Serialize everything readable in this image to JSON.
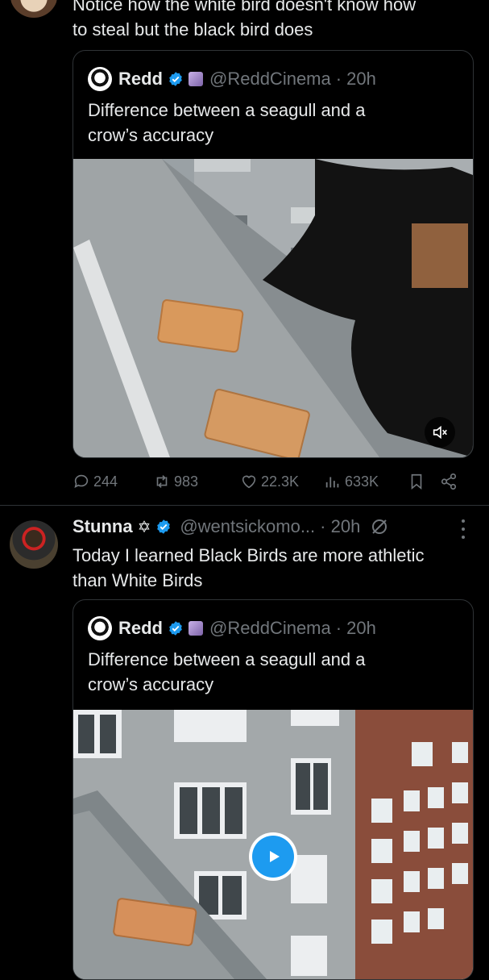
{
  "post1": {
    "text_line1": "Notice how the white bird doesn't know how",
    "text_line2": "to steal but the black bird does",
    "quote": {
      "name": "Redd",
      "handle": "@ReddCinema",
      "time": "· 20h",
      "text_line1": "Difference between a seagull and a",
      "text_line2": "crow’s accuracy"
    },
    "actions": {
      "replies": "244",
      "reposts": "983",
      "likes": "22.3K",
      "views": "633K"
    }
  },
  "post2": {
    "name": "Stunna",
    "handle": "@wentsickomo...",
    "time": "· 20h",
    "text_line1": "Today I learned Black Birds are more athletic",
    "text_line2": "than White Birds",
    "quote": {
      "name": "Redd",
      "handle": "@ReddCinema",
      "time": "· 20h",
      "text_line1": "Difference between a seagull and a",
      "text_line2": "crow’s accuracy"
    }
  },
  "icons": {
    "mute": "speaker-muted-icon",
    "play": "play-icon",
    "verified_color": "#1d9bf0",
    "play_color": "#1d9bf0"
  }
}
